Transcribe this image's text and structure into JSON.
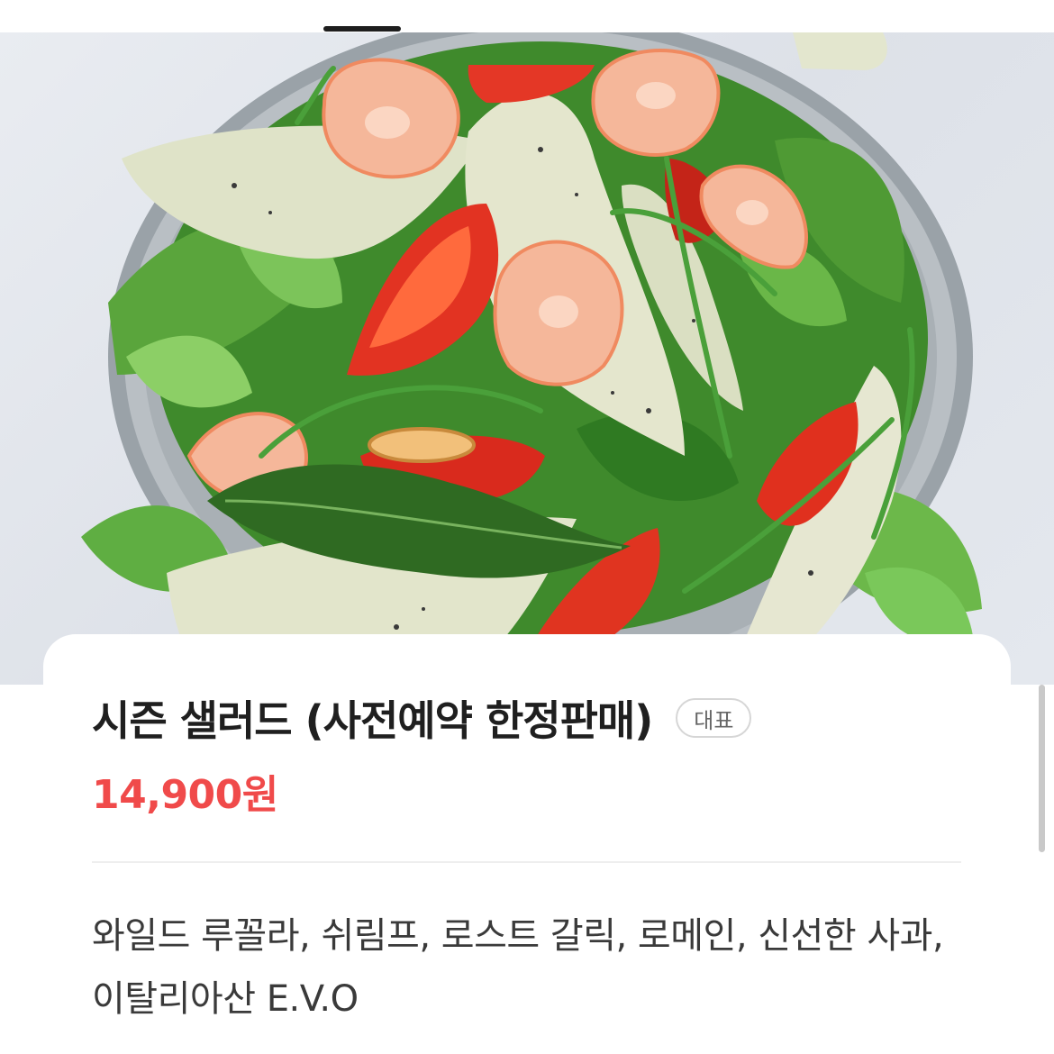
{
  "product": {
    "image_alt": "salad-photo",
    "name": "시즌 샐러드 (사전예약 한정판매)",
    "badge": "대표",
    "price": "14,900원",
    "description": "와일드 루꼴라, 쉬림프, 로스트 갈릭, 로메인, 신선한 사과, 이탈리아산 E.V.O"
  },
  "colors": {
    "price": "#f04a4a",
    "title": "#1f1f1f",
    "badge_border": "#d6d6d6"
  }
}
